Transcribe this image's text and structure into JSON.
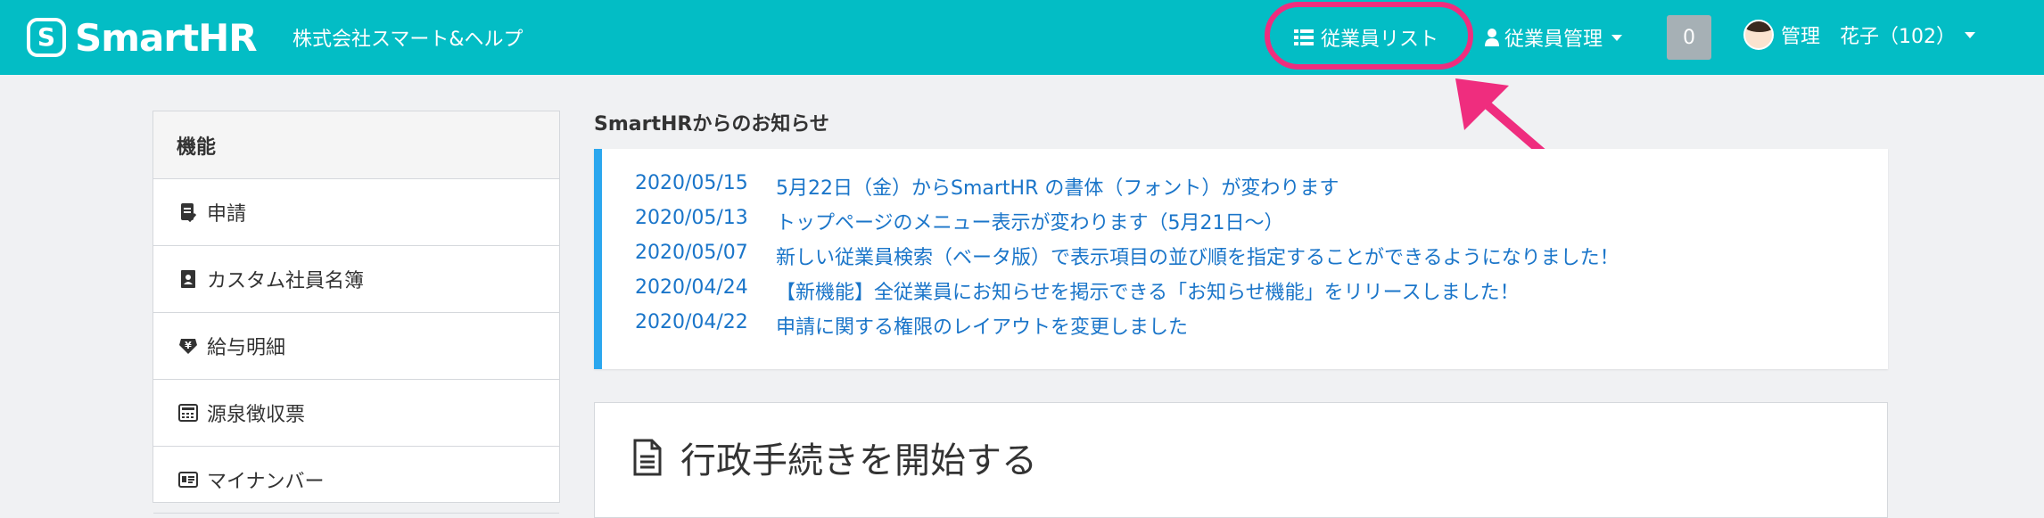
{
  "header": {
    "logo_mark": "S",
    "logo_text": "SmartHR",
    "company": "株式会社スマート&ヘルプ",
    "nav_list": "従業員リスト",
    "nav_manage": "従業員管理",
    "badge_count": "0",
    "user": "管理　花子（102）",
    "colors": {
      "bar": "#03bdc5",
      "highlight": "#ef2d7e"
    },
    "icons": [
      "list-icon",
      "user-icon",
      "chevron-down-icon"
    ]
  },
  "sidebar": {
    "title": "機能",
    "items": [
      {
        "label": "申請",
        "icon": "checklist-icon"
      },
      {
        "label": "カスタム社員名簿",
        "icon": "contact-book-icon"
      },
      {
        "label": "給与明細",
        "icon": "yen-icon"
      },
      {
        "label": "源泉徴収票",
        "icon": "calculator-icon"
      },
      {
        "label": "マイナンバー",
        "icon": "id-card-icon"
      }
    ]
  },
  "notices": {
    "title": "SmartHRからのお知らせ",
    "items": [
      {
        "date": "2020/05/15",
        "text": "5月22日（金）からSmartHR の書体（フォント）が変わります"
      },
      {
        "date": "2020/05/13",
        "text": "トップページのメニュー表示が変わります（5月21日〜）"
      },
      {
        "date": "2020/05/07",
        "text": "新しい従業員検索（ベータ版）で表示項目の並び順を指定することができるようになりました！"
      },
      {
        "date": "2020/04/24",
        "text": "【新機能】全従業員にお知らせを掲示できる「お知らせ機能」をリリースしました！"
      },
      {
        "date": "2020/04/22",
        "text": "申請に関する権限のレイアウトを変更しました"
      }
    ]
  },
  "procedures": {
    "title": "行政手続きを開始する",
    "icon": "document-icon"
  }
}
